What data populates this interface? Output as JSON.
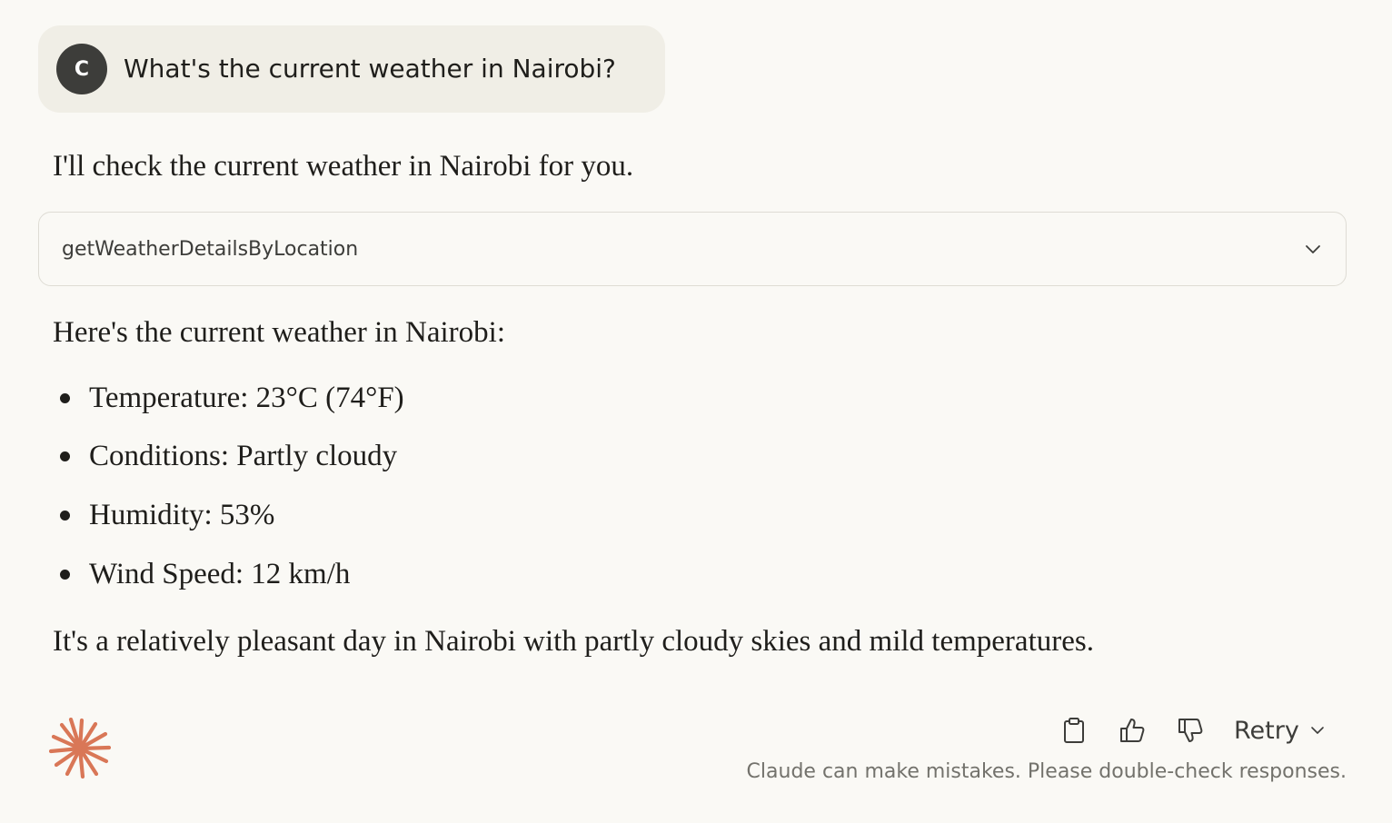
{
  "user_message": {
    "avatar_initial": "C",
    "text": "What's the current weather in Nairobi?"
  },
  "assistant": {
    "intro": "I'll check the current weather in Nairobi for you.",
    "tool_call": {
      "name": "getWeatherDetailsByLocation",
      "expand_icon": "chevron-down-icon"
    },
    "heading": "Here's the current weather in Nairobi:",
    "bullets": [
      "Temperature: 23°C (74°F)",
      "Conditions: Partly cloudy",
      "Humidity: 53%",
      "Wind Speed: 12 km/h"
    ],
    "summary": "It's a relatively pleasant day in Nairobi with partly cloudy skies and mild temperatures."
  },
  "actions": {
    "icons": [
      "copy-icon",
      "thumbs-up-icon",
      "thumbs-down-icon"
    ],
    "retry_label": "Retry"
  },
  "disclaimer": "Claude can make mistakes. Please double-check responses.",
  "colors": {
    "background": "#faf9f5",
    "user_bubble": "#f0eee6",
    "avatar": "#3d3d3a",
    "brand_accent": "#d97757",
    "text": "#1f1e1b",
    "muted_text": "#73726c"
  }
}
